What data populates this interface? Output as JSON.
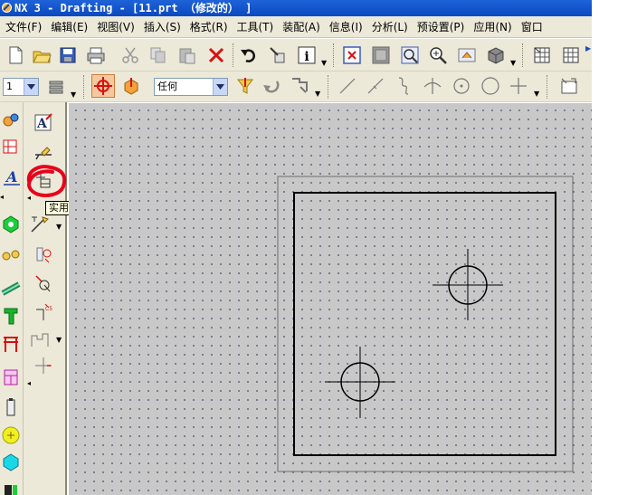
{
  "window": {
    "title": "NX 3 - Drafting - [11.prt （修改的） ]"
  },
  "menubar": {
    "items": [
      {
        "label": "文件(F)"
      },
      {
        "label": "编辑(E)"
      },
      {
        "label": "视图(V)"
      },
      {
        "label": "插入(S)"
      },
      {
        "label": "格式(R)"
      },
      {
        "label": "工具(T)"
      },
      {
        "label": "装配(A)"
      },
      {
        "label": "信息(I)"
      },
      {
        "label": "分析(L)"
      },
      {
        "label": "预设置(P)"
      },
      {
        "label": "应用(N)"
      },
      {
        "label": "窗口"
      }
    ]
  },
  "toolbar_standard": {
    "icons": [
      "new-file-icon",
      "open-folder-icon",
      "save-icon",
      "print-icon",
      "cut-icon",
      "copy-icon",
      "paste-icon",
      "delete-icon",
      "undo-icon",
      "info-tool-icon",
      "info-icon",
      "fit-view-icon",
      "zoom-region-icon",
      "zoom-window-icon",
      "zoom-icon",
      "view-tool-icon",
      "shaded-icon",
      "table-icon",
      "table-grid-icon"
    ]
  },
  "toolbar_selection": {
    "layer_value": "1",
    "filter_value": "任何",
    "colors": {
      "snap_active": "#f5c9a0"
    }
  },
  "left_toolbar": {
    "icons": [
      "assembly-icon",
      "view-layout-icon",
      "text-style-icon",
      "hexagon-icon",
      "chain-icon",
      "pipe-icon",
      "t-shape-icon",
      "gate-icon",
      "pink-connector-icon",
      "battery-icon",
      "yellow-circle-icon",
      "cyan-hexagon-icon",
      "block-icon"
    ]
  },
  "annotation_toolbar": {
    "icons": [
      "note-icon",
      "weld-symbol-icon",
      "utility-symbol-icon",
      "section-line-icon",
      "surface-finish-icon",
      "gdt-icon",
      "datum-icon",
      "crosshatch-icon",
      "offset-line-icon"
    ],
    "tooltip": "实用符号"
  },
  "colors": {
    "titlebar": "#1f63d8",
    "toolbar_bg": "#ece9d8",
    "canvas_bg": "#c8c8c8",
    "highlight_red": "#e8001c"
  }
}
